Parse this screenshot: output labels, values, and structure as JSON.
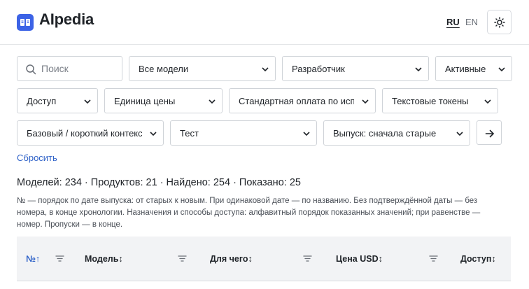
{
  "header": {
    "logo_text": "AIpedia",
    "lang_ru": "RU",
    "lang_en": "EN",
    "active_lang": "RU",
    "theme_icon": "sun-icon"
  },
  "filters": {
    "search_placeholder": "Поиск",
    "models": "Все модели",
    "developer": "Разработчик",
    "status": "Активные",
    "access": "Доступ",
    "price_unit": "Единица цены",
    "pricing": "Стандартная оплата по использованию",
    "tokens": "Текстовые токены",
    "context": "Базовый / короткий контекст",
    "test": "Тест",
    "sort": "Выпуск: сначала старые",
    "apply_icon": "arrow-right-icon"
  },
  "reset_label": "Сбросить",
  "stats": "Моделей: 234 · Продуктов: 21 · Найдено: 254 · Показано: 25",
  "note": "№ — порядок по дате выпуска: от старых к новым. При одинаковой дате — по названию. Без подтверждённой даты — без номера, в конце хронологии. Назначения и способы доступа: алфавитный порядок показанных значений; при равенстве — номер. Пропуски — в конце.",
  "table": {
    "columns": [
      {
        "label": "№↑",
        "active": true
      },
      {
        "label": "Модель↕",
        "active": false
      },
      {
        "label": "Для чего↕",
        "active": false
      },
      {
        "label": "Цена USD↕",
        "active": false
      },
      {
        "label": "Доступ↕",
        "active": false
      }
    ]
  },
  "colors": {
    "accent": "#3c63e6",
    "link": "#2f62c8",
    "header_bg": "#f2f3f5"
  }
}
